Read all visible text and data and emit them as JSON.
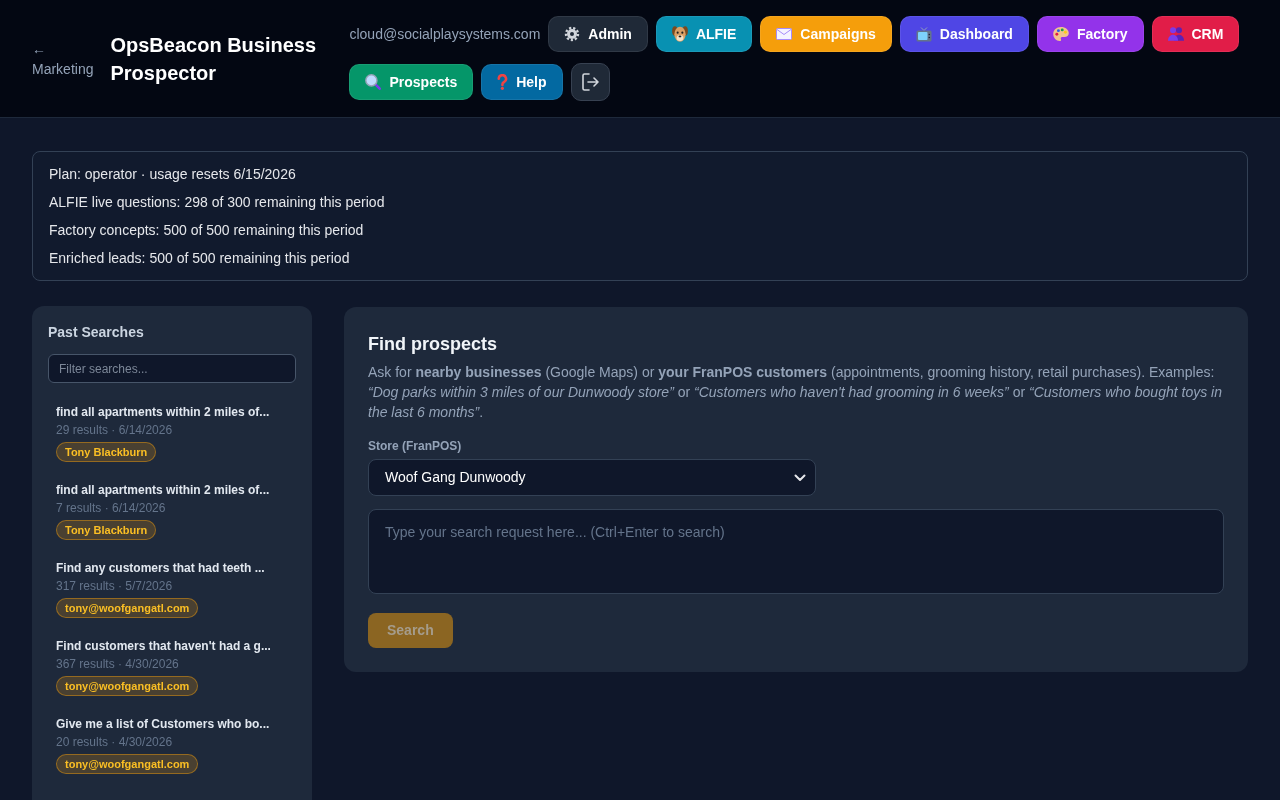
{
  "header": {
    "back_link": {
      "arrow": "←",
      "label": "Marketing"
    },
    "title": "OpsBeacon Business Prospector",
    "user_email": "cloud@socialplaysystems.com",
    "nav_buttons": [
      {
        "label": "Admin",
        "color": "#1f2937"
      },
      {
        "label": "ALFIE",
        "color": "#0891b2"
      },
      {
        "label": "Campaigns",
        "color": "#f59e0b"
      },
      {
        "label": "Dashboard",
        "color": "#4f46e5"
      },
      {
        "label": "Factory",
        "color": "#9333ea"
      },
      {
        "label": "CRM",
        "color": "#e11d48"
      },
      {
        "label": "Prospects",
        "color": "#059669"
      },
      {
        "label": "Help",
        "color": "#0369a1"
      }
    ]
  },
  "usage": [
    "Plan: operator · usage resets 6/15/2026",
    "ALFIE live questions: 298 of 300 remaining this period",
    "Factory concepts: 500 of 500 remaining this period",
    "Enriched leads: 500 of 500 remaining this period"
  ],
  "past_searches": {
    "title": "Past Searches",
    "filter": {
      "placeholder": "Filter searches..."
    },
    "items": [
      {
        "title": "find all apartments within 2 miles of...",
        "meta": "29 results · 6/14/2026",
        "owner": "Tony Blackburn"
      },
      {
        "title": "find all apartments within 2 miles of...",
        "meta": "7 results · 6/14/2026",
        "owner": "Tony Blackburn"
      },
      {
        "title": "Find any customers that had teeth ...",
        "meta": "317 results · 5/7/2026",
        "owner": "tony@woofgangatl.com"
      },
      {
        "title": "Find customers that haven't had a g...",
        "meta": "367 results · 4/30/2026",
        "owner": "tony@woofgangatl.com"
      },
      {
        "title": "Give me a list of Customers who bo...",
        "meta": "20 results · 4/30/2026",
        "owner": "tony@woofgangatl.com"
      }
    ]
  },
  "find_prospects": {
    "title": "Find prospects",
    "description": "Ask for **nearby businesses** (Google Maps) or **your FranPOS customers** (appointments, grooming history, retail purchases). Examples: *“Dog parks within 3 miles of our Dunwoody store”* or *“Customers who haven't had grooming in 6 weeks”* or *“Customers who bought toys in the last 6 months”*.",
    "store_field": {
      "label": "Store (FranPOS)",
      "value": "Woof Gang Dunwoody"
    },
    "request_field": {
      "placeholder": "Type your search request here... (Ctrl+Enter to search)"
    },
    "search_button": {
      "label": "Search",
      "disabled": true
    }
  }
}
